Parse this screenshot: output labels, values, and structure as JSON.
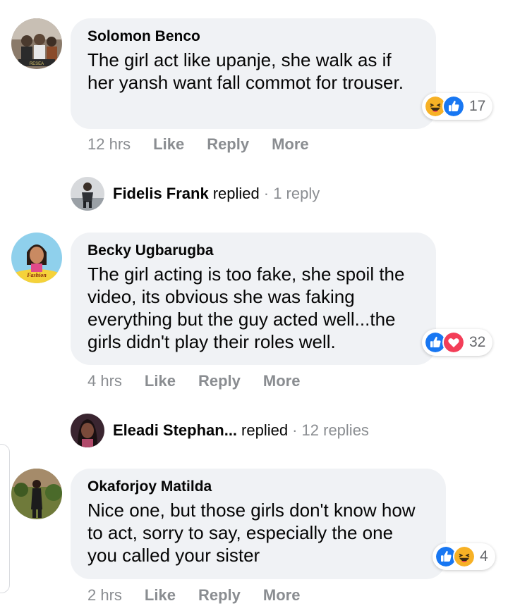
{
  "comments": [
    {
      "author": "Solomon Benco",
      "text": "The girl act like upanje, she walk as if her yansh want fall commot for trouser.",
      "reactions": [
        "laugh-reaction-icon",
        "like-reaction-icon"
      ],
      "reaction_count": "17",
      "time": "12 hrs",
      "actions": [
        "Like",
        "Reply",
        "More"
      ],
      "replies": {
        "author": "Fidelis Frank",
        "replied_label": "replied",
        "count_label": "· 1 reply"
      }
    },
    {
      "author": "Becky Ugbarugba",
      "text": "The girl acting is too fake, she spoil the video, its obvious she was faking everything but the guy acted well...the girls didn't play their roles well.",
      "reactions": [
        "like-reaction-icon",
        "love-reaction-icon"
      ],
      "reaction_count": "32",
      "time": "4 hrs",
      "actions": [
        "Like",
        "Reply",
        "More"
      ],
      "replies": {
        "author": "Eleadi Stephan...",
        "replied_label": "replied",
        "count_label": "· 12 replies"
      }
    },
    {
      "author": "Okaforjoy Matilda",
      "text": "Nice one, but those girls don't know how to act, sorry to say, especially the one you called your sister",
      "reactions": [
        "like-reaction-icon",
        "laugh-reaction-icon"
      ],
      "reaction_count": "4",
      "time": "2 hrs",
      "actions": [
        "Like",
        "Reply",
        "More"
      ]
    }
  ],
  "avatar_badges": {
    "solomon": "RESEA",
    "becky": "Fashion"
  },
  "colors": {
    "bubble": "#f0f2f5",
    "action_text": "#8a8d91",
    "like_blue": "#1877f2",
    "love_red": "#f33e58",
    "haha_yellow": "#f7b125"
  }
}
